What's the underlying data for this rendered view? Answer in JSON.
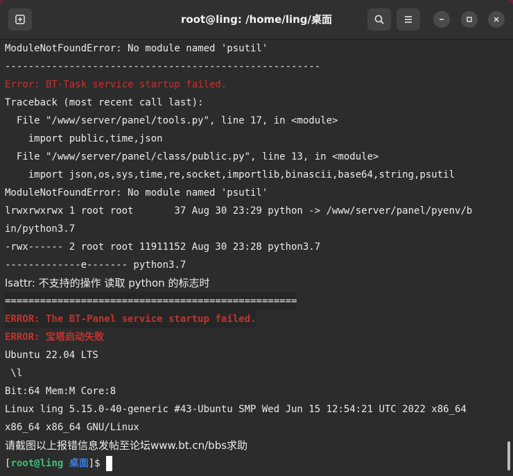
{
  "window": {
    "title": "root@ling: /home/ling/桌面",
    "buttons": {
      "new_tab": "new-tab-icon",
      "search": "search-icon",
      "menu": "hamburger-menu-icon",
      "minimize": "minimize-icon",
      "maximize": "maximize-icon",
      "close": "close-icon"
    }
  },
  "terminal": {
    "lines": [
      "ModuleNotFoundError: No module named 'psutil'",
      "------------------------------------------------------",
      "Error: BT-Task service startup failed.",
      "Traceback (most recent call last):",
      "  File \"/www/server/panel/tools.py\", line 17, in <module>",
      "    import public,time,json",
      "  File \"/www/server/panel/class/public.py\", line 13, in <module>",
      "    import json,os,sys,time,re,socket,importlib,binascii,base64,string,psutil",
      "ModuleNotFoundError: No module named 'psutil'",
      "lrwxrwxrwx 1 root root       37 Aug 30 23:29 python -> /www/server/panel/pyenv/b",
      "in/python3.7",
      "-rwx------ 2 root root 11911152 Aug 30 23:28 python3.7",
      "-------------e------- python3.7",
      "lsattr: 不支持的操作 读取 python 的标志时",
      "==================================================",
      "ERROR: The BT-Panel service startup failed.",
      "ERROR: 宝塔启动失败",
      "Ubuntu 22.04 LTS",
      " \\l",
      "Bit:64 Mem:M Core:8",
      "Linux ling 5.15.0-40-generic #43-Ubuntu SMP Wed Jun 15 12:54:21 UTC 2022 x86_64",
      "x86_64 x86_64 GNU/Linux",
      "请截图以上报错信息发帖至论坛www.bt.cn/bbs求助"
    ],
    "prompt": {
      "open_bracket": "[",
      "user_host": "root@ling",
      "dir": "桌面",
      "close": "]$"
    }
  },
  "colors": {
    "background": "#2c2c2c",
    "text": "#ececec",
    "error_red": "#c3332d",
    "prompt_green": "#3cc277",
    "prompt_blue": "#3f7ce0"
  }
}
